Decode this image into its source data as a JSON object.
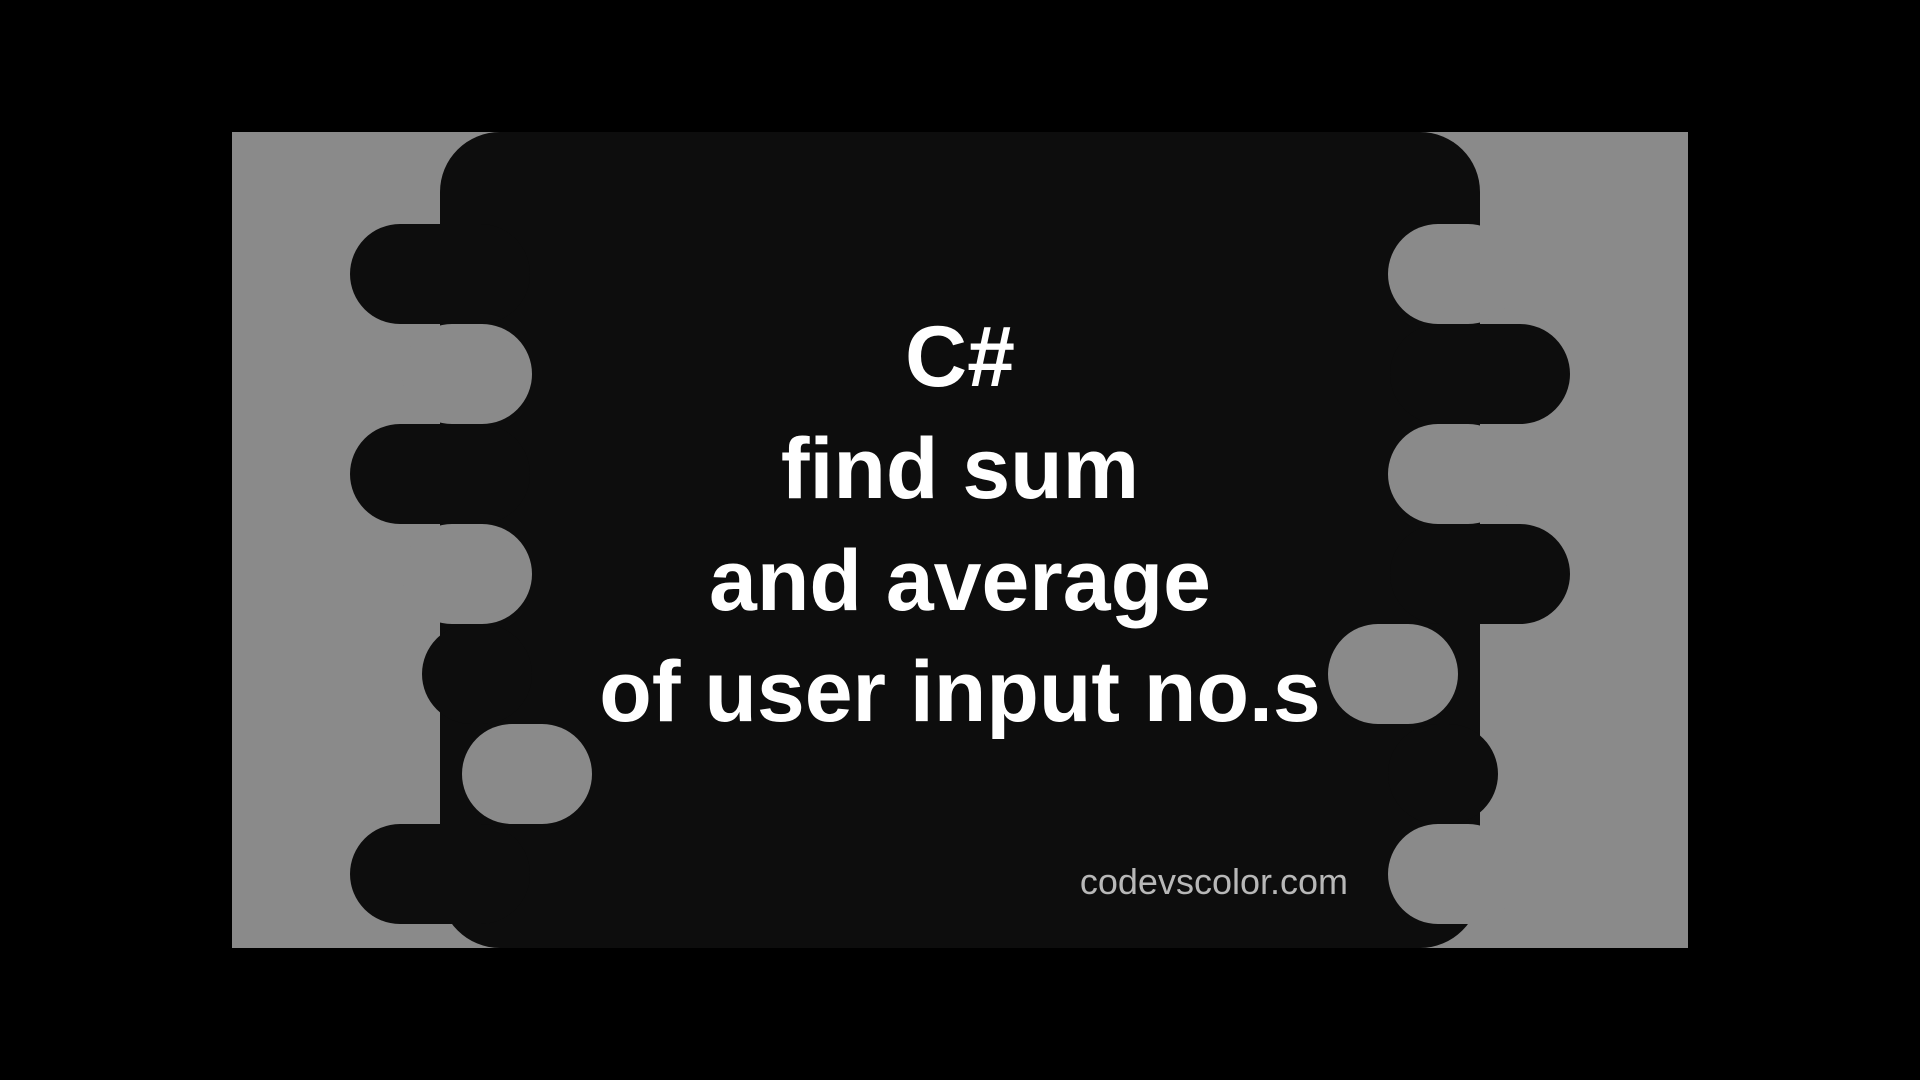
{
  "title": {
    "line1": "C#",
    "line2": "find sum",
    "line3": "and average",
    "line4": "of user input no.s"
  },
  "watermark": "codevscolor.com"
}
